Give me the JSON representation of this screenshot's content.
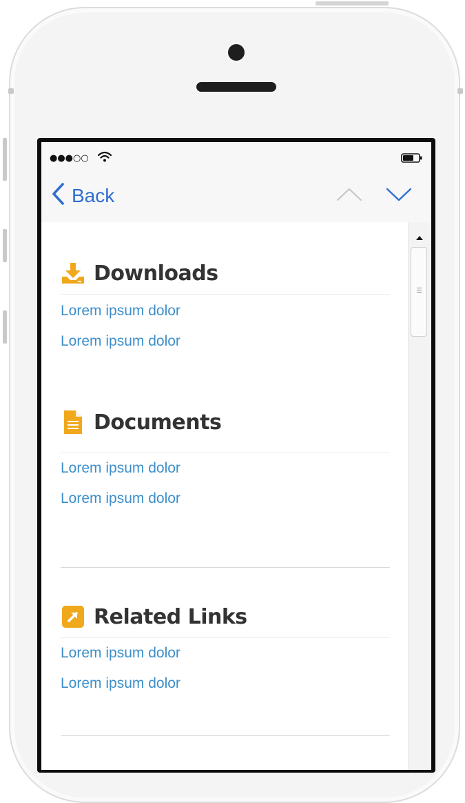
{
  "status_bar": {
    "signal": "●●●○○",
    "wifi_icon": "wifi-icon",
    "battery_icon": "battery-icon"
  },
  "nav": {
    "back_label": "Back",
    "back_icon": "chevron-left-icon",
    "prev_icon": "chevron-up-icon",
    "next_icon": "chevron-down-icon",
    "accent_color": "#2f6fd0"
  },
  "sections": [
    {
      "title": "Downloads",
      "icon": "download-icon",
      "icon_color": "#f0a81c",
      "links": [
        "Lorem ipsum dolor",
        "Lorem ipsum dolor"
      ]
    },
    {
      "title": "Documents",
      "icon": "document-icon",
      "icon_color": "#f0a81c",
      "links": [
        "Lorem ipsum dolor",
        "Lorem ipsum dolor"
      ]
    },
    {
      "title": "Related Links",
      "icon": "external-link-icon",
      "icon_color": "#f0a81c",
      "links": [
        "Lorem ipsum dolor",
        "Lorem ipsum dolor"
      ]
    }
  ],
  "link_color": "#3c8fca"
}
